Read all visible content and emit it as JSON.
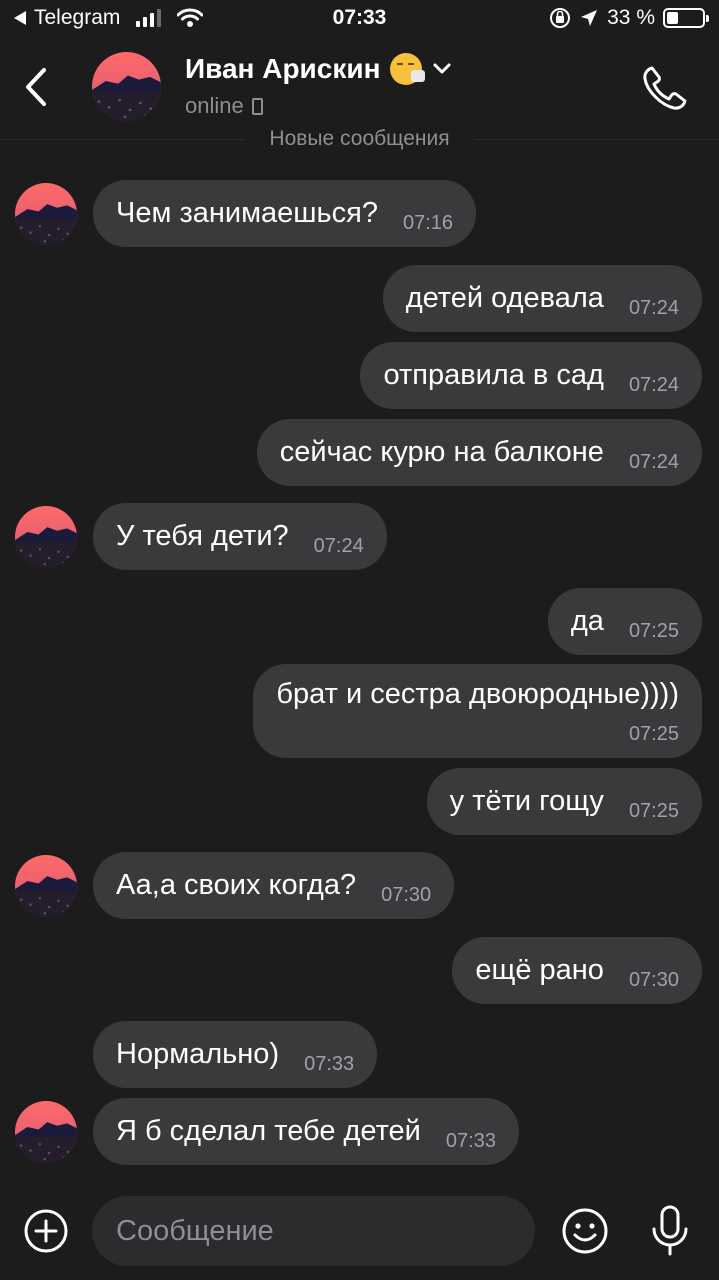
{
  "statusbar": {
    "back_app": "Telegram",
    "time": "07:33",
    "battery": "33 %",
    "battery_level": 0.33
  },
  "header": {
    "name": "Иван Арискин",
    "status": "online"
  },
  "divider": "Новые сообщения",
  "messages": [
    {
      "text": "Чем занимаешься?",
      "time": "07:16"
    },
    {
      "text": "детей одевала",
      "time": "07:24"
    },
    {
      "text": "отправила в сад",
      "time": "07:24"
    },
    {
      "text": "сейчас курю на балконе",
      "time": "07:24"
    },
    {
      "text": "У тебя дети?",
      "time": "07:24"
    },
    {
      "text": "да",
      "time": "07:25"
    },
    {
      "text": "брат и сестра двоюродные))))",
      "time": "07:25"
    },
    {
      "text": "у тёти гощу",
      "time": "07:25"
    },
    {
      "text": "Аа,а своих когда?",
      "time": "07:30"
    },
    {
      "text": "ещё рано",
      "time": "07:30"
    },
    {
      "text": "Нормально)",
      "time": "07:33"
    },
    {
      "text": "Я б сделал тебе детей",
      "time": "07:33"
    }
  ],
  "input": {
    "placeholder": "Сообщение"
  }
}
